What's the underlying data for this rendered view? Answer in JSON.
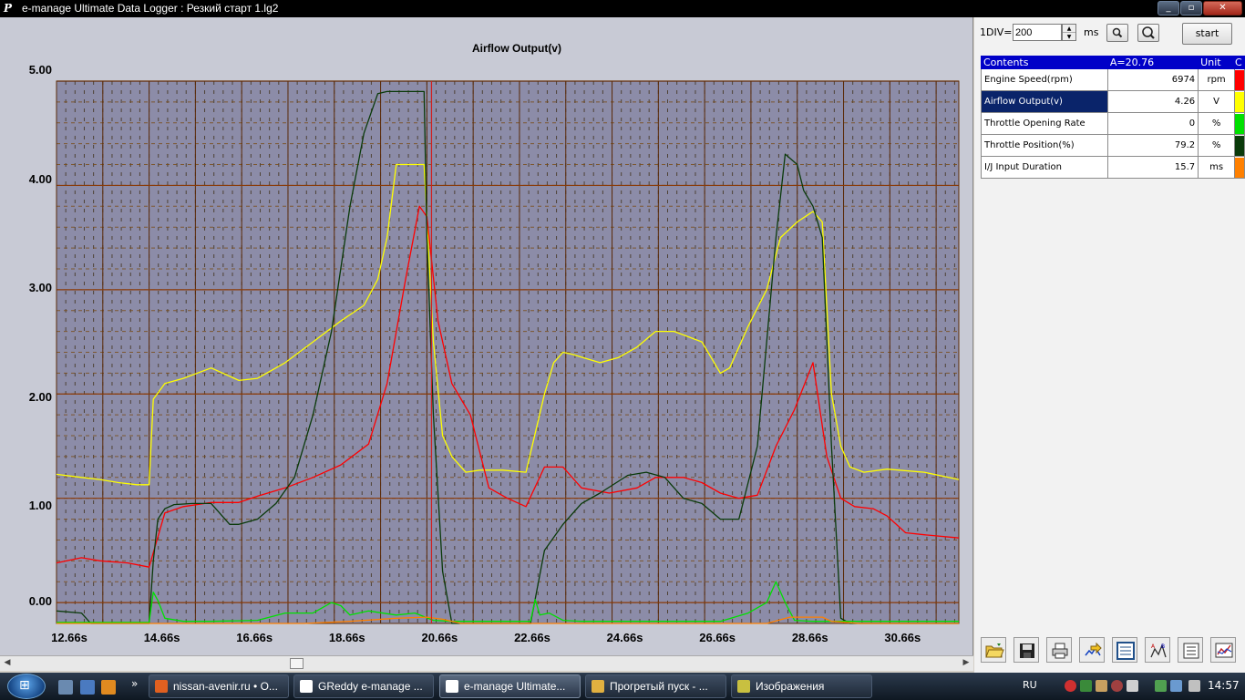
{
  "window": {
    "logo": "P",
    "title": "e-manage Ultimate Data Logger : Резкий старт 1.lg2"
  },
  "chart": {
    "title": "Airflow Output(v)",
    "y_tick_labels": [
      "5.00",
      "4.00",
      "3.00",
      "2.00",
      "1.00",
      "0.00"
    ],
    "x_tick_labels": [
      "12.66s",
      "14.66s",
      "16.66s",
      "18.66s",
      "20.66s",
      "22.66s",
      "24.66s",
      "26.66s",
      "28.66s",
      "30.66s"
    ]
  },
  "chart_data": {
    "type": "line",
    "title": "Airflow Output(v)",
    "xlabel": "",
    "ylabel": "",
    "xlim": [
      12.66,
      32.15
    ],
    "ylim": [
      -0.2,
      5.0
    ],
    "x_ticks": [
      12.66,
      14.66,
      16.66,
      18.66,
      20.66,
      22.66,
      24.66,
      26.66,
      28.66,
      30.66
    ],
    "y_ticks": [
      0,
      1,
      2,
      3,
      4,
      5
    ],
    "grid": true,
    "cursor_x": 20.76,
    "series": [
      {
        "color": "#ffff00",
        "x": [
          12.66,
          13.2,
          13.6,
          14.0,
          14.4,
          14.66,
          14.75,
          15.0,
          15.4,
          16.0,
          16.6,
          17.0,
          17.6,
          18.2,
          18.8,
          19.3,
          19.6,
          19.8,
          20.0,
          20.6,
          20.8,
          21.0,
          21.2,
          21.5,
          21.8,
          22.3,
          22.8,
          23.2,
          23.4,
          23.6,
          23.8,
          24.4,
          24.8,
          25.2,
          25.6,
          26.0,
          26.6,
          27.0,
          27.2,
          27.6,
          28.0,
          28.3,
          28.66,
          29.0,
          29.2,
          29.4,
          29.6,
          29.8,
          30.1,
          30.6,
          31.4,
          32.15
        ],
        "values": [
          1.23,
          1.2,
          1.18,
          1.15,
          1.13,
          1.13,
          1.95,
          2.1,
          2.15,
          2.25,
          2.13,
          2.15,
          2.3,
          2.5,
          2.7,
          2.85,
          3.1,
          3.5,
          4.2,
          4.2,
          2.5,
          1.6,
          1.4,
          1.25,
          1.27,
          1.27,
          1.25,
          2.0,
          2.3,
          2.4,
          2.38,
          2.3,
          2.35,
          2.45,
          2.6,
          2.6,
          2.5,
          2.2,
          2.25,
          2.65,
          3.0,
          3.5,
          3.65,
          3.75,
          3.65,
          2.0,
          1.5,
          1.3,
          1.25,
          1.28,
          1.25,
          1.18
        ]
      },
      {
        "color": "#ff0000",
        "x": [
          12.66,
          13.2,
          13.6,
          14.2,
          14.66,
          15.0,
          15.4,
          16.0,
          16.6,
          17.0,
          17.6,
          18.2,
          18.8,
          19.4,
          19.8,
          20.2,
          20.5,
          20.66,
          20.9,
          21.2,
          21.6,
          22.0,
          22.4,
          22.8,
          23.2,
          23.6,
          24.0,
          24.6,
          25.2,
          25.6,
          26.2,
          26.6,
          27.0,
          27.4,
          27.8,
          28.2,
          28.6,
          29.0,
          29.3,
          29.6,
          29.9,
          30.3,
          30.6,
          31.0,
          31.4,
          32.15
        ],
        "values": [
          0.38,
          0.43,
          0.4,
          0.38,
          0.34,
          0.86,
          0.92,
          0.96,
          0.96,
          1.02,
          1.1,
          1.2,
          1.32,
          1.52,
          2.1,
          3.1,
          3.8,
          3.7,
          2.7,
          2.1,
          1.8,
          1.1,
          1.0,
          0.92,
          1.3,
          1.3,
          1.1,
          1.05,
          1.1,
          1.2,
          1.2,
          1.15,
          1.05,
          1.0,
          1.03,
          1.5,
          1.85,
          2.3,
          1.4,
          1.0,
          0.92,
          0.9,
          0.83,
          0.67,
          0.65,
          0.62
        ]
      },
      {
        "color": "#0a3a0a",
        "x": [
          12.66,
          13.2,
          13.4,
          13.6,
          14.66,
          14.75,
          14.85,
          15.0,
          15.2,
          15.6,
          16.0,
          16.4,
          16.6,
          17.0,
          17.4,
          17.8,
          18.2,
          18.6,
          19.0,
          19.3,
          19.6,
          19.8,
          20.6,
          20.66,
          20.8,
          21.0,
          21.2,
          21.5,
          22.0,
          22.5,
          22.9,
          23.2,
          23.6,
          24.0,
          24.4,
          25.0,
          25.4,
          25.8,
          26.2,
          26.6,
          27.0,
          27.4,
          27.8,
          28.2,
          28.4,
          28.66,
          28.8,
          29.0,
          29.2,
          29.4,
          29.6,
          29.8,
          30.0,
          30.4,
          31.0,
          32.15
        ],
        "values": [
          -0.08,
          -0.1,
          -0.2,
          -0.2,
          -0.2,
          0.4,
          0.8,
          0.9,
          0.94,
          0.95,
          0.95,
          0.75,
          0.75,
          0.8,
          0.95,
          1.2,
          1.8,
          2.6,
          3.8,
          4.5,
          4.88,
          4.9,
          4.9,
          3.5,
          1.8,
          0.3,
          -0.2,
          -0.2,
          -0.2,
          -0.2,
          -0.2,
          0.5,
          0.75,
          0.95,
          1.05,
          1.22,
          1.25,
          1.2,
          1.0,
          0.95,
          0.8,
          0.8,
          1.5,
          3.5,
          4.3,
          4.2,
          3.95,
          3.8,
          3.5,
          1.5,
          -0.15,
          -0.2,
          -0.2,
          -0.2,
          -0.2,
          -0.2
        ]
      },
      {
        "color": "#00e000",
        "x": [
          12.66,
          14.66,
          14.75,
          14.85,
          15.0,
          15.4,
          16.0,
          17.0,
          17.6,
          18.2,
          18.6,
          18.8,
          19.0,
          19.4,
          20.0,
          20.4,
          20.8,
          21.2,
          22.5,
          22.9,
          23.0,
          23.1,
          23.3,
          23.6,
          24.0,
          26.0,
          27.0,
          27.6,
          28.0,
          28.2,
          28.4,
          28.6,
          29.0,
          32.15
        ],
        "values": [
          -0.19,
          -0.19,
          0.1,
          0.02,
          -0.15,
          -0.18,
          -0.18,
          -0.17,
          -0.1,
          -0.1,
          0.0,
          -0.03,
          -0.12,
          -0.08,
          -0.12,
          -0.1,
          -0.17,
          -0.18,
          -0.18,
          -0.18,
          0.03,
          -0.12,
          -0.1,
          -0.17,
          -0.18,
          -0.18,
          -0.18,
          -0.1,
          0.0,
          0.2,
          0.0,
          -0.17,
          -0.18,
          -0.18
        ]
      },
      {
        "color": "#ff8000",
        "x": [
          12.66,
          18.0,
          19.0,
          20.0,
          20.66,
          21.0,
          21.4,
          26.0,
          28.0,
          28.5,
          29.2,
          29.4,
          30.0,
          32.15
        ],
        "values": [
          -0.2,
          -0.2,
          -0.18,
          -0.15,
          -0.14,
          -0.16,
          -0.2,
          -0.2,
          -0.2,
          -0.14,
          -0.14,
          -0.18,
          -0.2,
          -0.2
        ]
      }
    ]
  },
  "controls": {
    "div_label": "1DIV=",
    "div_value": "200",
    "div_unit": "ms",
    "spin_up": "▲",
    "spin_down": "▼",
    "start_label": "start"
  },
  "table": {
    "headers": [
      "Contents",
      "A=20.76",
      "Unit",
      "C"
    ],
    "rows": [
      {
        "name": "Engine Speed(rpm)",
        "value": "6974",
        "unit": "rpm",
        "color": "#ff0000",
        "selected": false
      },
      {
        "name": "Airflow Output(v)",
        "value": "4.26",
        "unit": "V",
        "color": "#ffff00",
        "selected": true
      },
      {
        "name": "Throttle Opening Rate",
        "value": "0",
        "unit": "%",
        "color": "#00e000",
        "selected": false
      },
      {
        "name": "Throttle Position(%)",
        "value": "79.2",
        "unit": "%",
        "color": "#0a3a0a",
        "selected": false
      },
      {
        "name": "I/J Input Duration",
        "value": "15.7",
        "unit": "ms",
        "color": "#ff8000",
        "selected": false
      }
    ]
  },
  "toolbar_icons": [
    "open-folder-icon",
    "save-icon",
    "print-icon",
    "export-icon",
    "view-icon",
    "ab-chart-icon",
    "list-icon",
    "settings-chart-icon"
  ],
  "taskbar": {
    "tasks": [
      {
        "label": "nissan-avenir.ru • О...",
        "icon_color": "#e06020",
        "active": false
      },
      {
        "label": "GReddy e-manage ...",
        "icon_color": "#ffffff",
        "active": false
      },
      {
        "label": "e-manage Ultimate...",
        "icon_color": "#ffffff",
        "active": true
      },
      {
        "label": "Прогретый пуск - ...",
        "icon_color": "#e0b040",
        "active": false
      },
      {
        "label": "Изображения",
        "icon_color": "#c8c040",
        "active": false
      }
    ],
    "language": "RU",
    "clock": "14:57",
    "ql_more": "»"
  }
}
